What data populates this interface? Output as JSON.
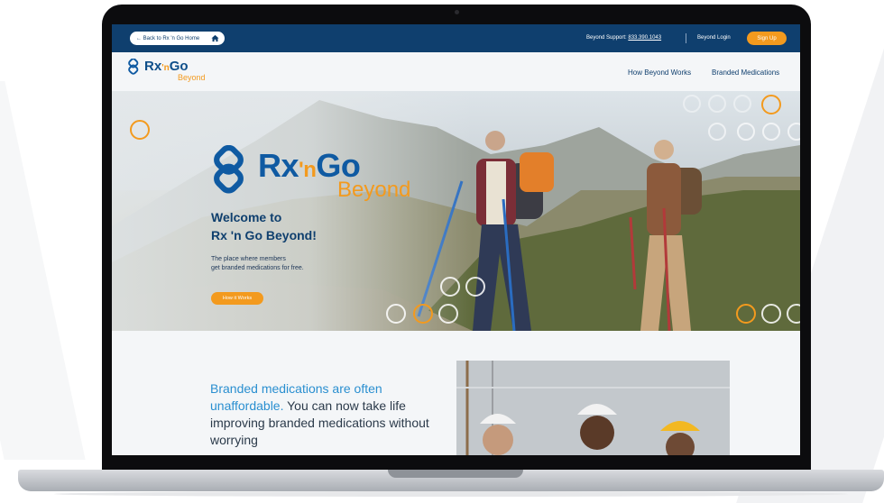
{
  "topbar": {
    "back_label": "← Back to Rx 'n Go Home",
    "support_label": "Beyond Support:",
    "support_number": "833.390.1043",
    "login_label": "Beyond Login",
    "signup_label": "Sign Up"
  },
  "nav": {
    "logo_rx": "Rx",
    "logo_n": "'n",
    "logo_go": "Go",
    "logo_beyond": "Beyond",
    "links": [
      "How Beyond Works",
      "Branded Medications"
    ]
  },
  "hero": {
    "logo_rx": "Rx",
    "logo_n": "'n",
    "logo_go": "Go",
    "logo_beyond": "Beyond",
    "title_line1": "Welcome to",
    "title_line2": "Rx 'n Go Beyond!",
    "subtitle_line1": "The place where members",
    "subtitle_line2": "get branded medications for free.",
    "cta_label": "How it Works"
  },
  "section": {
    "headline_highlight": "Branded medications are often unaffordable.",
    "headline_rest": " You can now take life improving branded medications without worrying"
  },
  "colors": {
    "navy": "#0f3f6e",
    "brand_blue": "#0f5aa2",
    "accent_orange": "#f39a1e",
    "highlight_blue": "#2a8fd0"
  },
  "icons": {
    "home": "home-icon",
    "logo_mark": "logo-mark-icon"
  }
}
